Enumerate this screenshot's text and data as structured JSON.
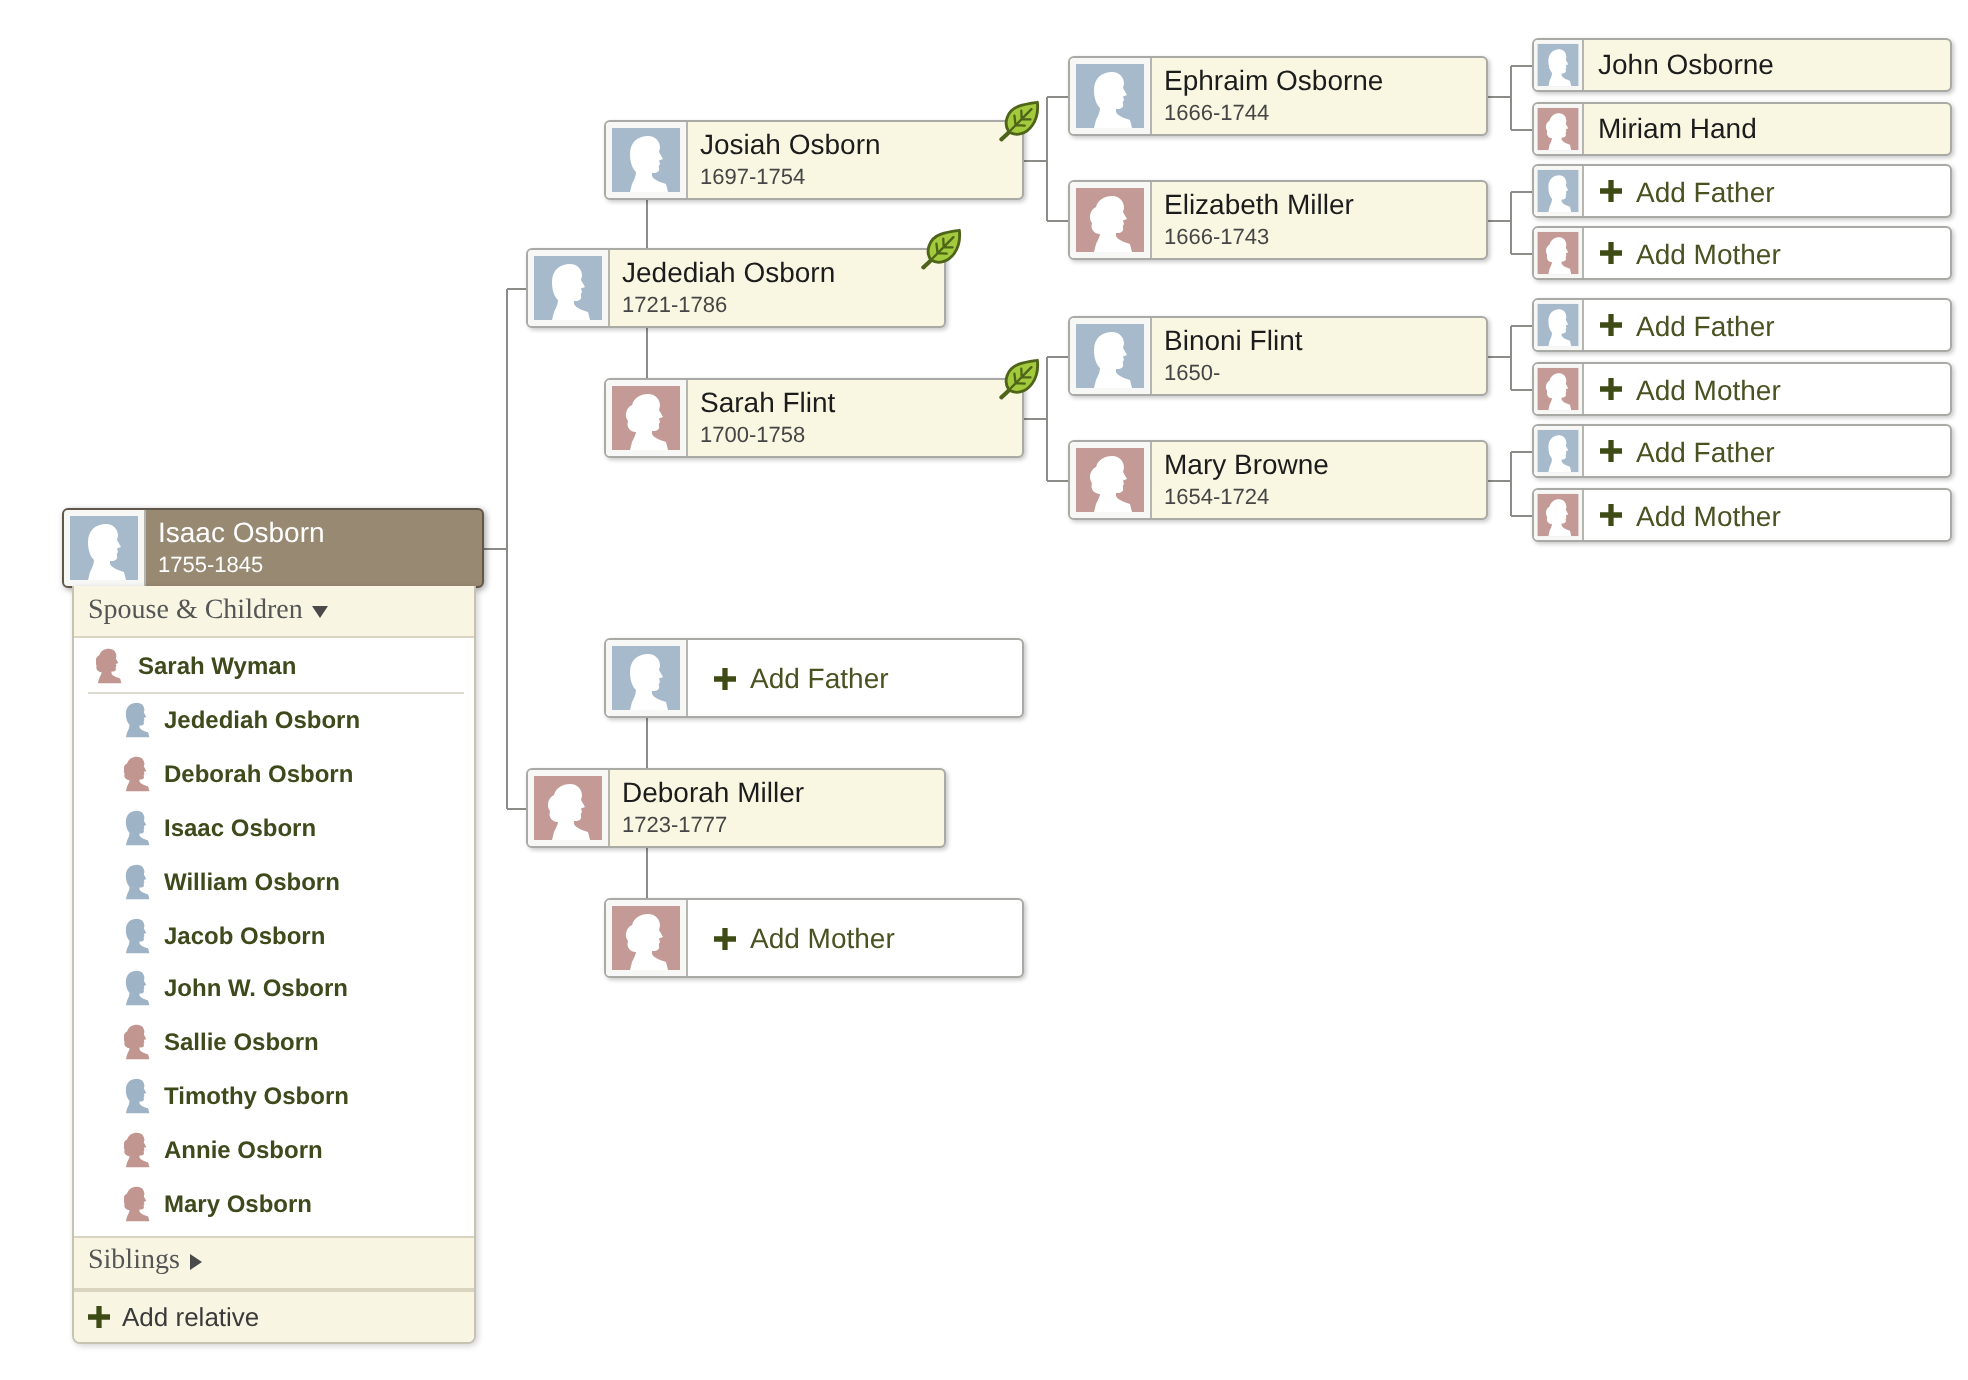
{
  "pedigree": {
    "kind": "person",
    "name": "Isaac Osborn",
    "dates": "1755-1845",
    "avatar": {
      "kind": "male",
      "color": "#a6bacb"
    },
    "selected": true,
    "hint": false,
    "parents": [
      {
        "kind": "person",
        "name": "Jedediah Osborn",
        "dates": "1721-1786",
        "avatar": {
          "kind": "male",
          "color": "#a6bacb"
        },
        "selected": false,
        "hint": true,
        "parents": [
          {
            "kind": "person",
            "name": "Josiah Osborn",
            "dates": "1697-1754",
            "avatar": {
              "kind": "male",
              "color": "#a6bacb"
            },
            "selected": false,
            "hint": true,
            "parents": [
              {
                "kind": "person",
                "name": "Ephraim Osborne",
                "dates": "1666-1744",
                "avatar": {
                  "kind": "male",
                  "color": "#a6bacb"
                },
                "selected": false,
                "hint": false,
                "parents": [
                  {
                    "kind": "person",
                    "name": "John Osborne",
                    "avatar": {
                      "kind": "male",
                      "color": "#a6bacb"
                    },
                    "selected": false,
                    "hint": false
                  },
                  {
                    "kind": "person",
                    "name": "Miriam Hand",
                    "avatar": {
                      "kind": "female",
                      "color": "#c39a95"
                    },
                    "selected": false,
                    "hint": false
                  }
                ]
              },
              {
                "kind": "person",
                "name": "Elizabeth Miller",
                "dates": "1666-1743",
                "avatar": {
                  "kind": "female",
                  "color": "#c39a95"
                },
                "selected": false,
                "hint": false,
                "parents": [
                  {
                    "kind": "add",
                    "label": "Add Father",
                    "avatar": {
                      "kind": "male",
                      "color": "#a6bacb"
                    }
                  },
                  {
                    "kind": "add",
                    "label": "Add Mother",
                    "avatar": {
                      "kind": "female",
                      "color": "#c39a95"
                    }
                  }
                ]
              }
            ]
          },
          {
            "kind": "person",
            "name": "Sarah Flint",
            "dates": "1700-1758",
            "avatar": {
              "kind": "female",
              "color": "#c39a95"
            },
            "selected": false,
            "hint": true,
            "parents": [
              {
                "kind": "person",
                "name": "Binoni Flint",
                "dates": "1650-",
                "avatar": {
                  "kind": "male",
                  "color": "#a6bacb"
                },
                "selected": false,
                "hint": false,
                "parents": [
                  {
                    "kind": "add",
                    "label": "Add Father",
                    "avatar": {
                      "kind": "male",
                      "color": "#a6bacb"
                    }
                  },
                  {
                    "kind": "add",
                    "label": "Add Mother",
                    "avatar": {
                      "kind": "female",
                      "color": "#c39a95"
                    }
                  }
                ]
              },
              {
                "kind": "person",
                "name": "Mary Browne",
                "dates": "1654-1724",
                "avatar": {
                  "kind": "female",
                  "color": "#c39a95"
                },
                "selected": false,
                "hint": false,
                "parents": [
                  {
                    "kind": "add",
                    "label": "Add Father",
                    "avatar": {
                      "kind": "male",
                      "color": "#a6bacb"
                    }
                  },
                  {
                    "kind": "add",
                    "label": "Add Mother",
                    "avatar": {
                      "kind": "female",
                      "color": "#c39a95"
                    }
                  }
                ]
              }
            ]
          }
        ]
      },
      {
        "kind": "person",
        "name": "Deborah Miller",
        "dates": "1723-1777",
        "avatar": {
          "kind": "female",
          "color": "#c39a95"
        },
        "selected": false,
        "hint": false,
        "parents": [
          {
            "kind": "add",
            "label": "Add Father",
            "avatar": {
              "kind": "male",
              "color": "#a6bacb"
            }
          },
          {
            "kind": "add",
            "label": "Add Mother",
            "avatar": {
              "kind": "female",
              "color": "#c39a95"
            }
          }
        ]
      }
    ]
  },
  "family_panel": {
    "sections": [
      {
        "title": "Spouse & Children",
        "expanded": true,
        "spouse": {
          "name": "Sarah Wyman",
          "avatar": {
            "kind": "female",
            "color": "#c29690"
          }
        },
        "children": [
          {
            "name": "Jedediah Osborn",
            "avatar": {
              "kind": "male",
              "color": "#9fb3c6"
            }
          },
          {
            "name": "Deborah Osborn",
            "avatar": {
              "kind": "female",
              "color": "#c29690"
            }
          },
          {
            "name": "Isaac Osborn",
            "avatar": {
              "kind": "male",
              "color": "#9fb3c6"
            }
          },
          {
            "name": "William Osborn",
            "avatar": {
              "kind": "male",
              "color": "#9fb3c6"
            }
          },
          {
            "name": "Jacob Osborn",
            "avatar": {
              "kind": "male",
              "color": "#9fb3c6"
            }
          },
          {
            "name": "John W. Osborn",
            "avatar": {
              "kind": "male",
              "color": "#9fb3c6"
            }
          },
          {
            "name": "Sallie Osborn",
            "avatar": {
              "kind": "female",
              "color": "#c29690"
            }
          },
          {
            "name": "Timothy Osborn",
            "avatar": {
              "kind": "male",
              "color": "#9fb3c6"
            }
          },
          {
            "name": "Annie Osborn",
            "avatar": {
              "kind": "female",
              "color": "#c29690"
            }
          },
          {
            "name": "Mary Osborn",
            "avatar": {
              "kind": "female",
              "color": "#c29690"
            }
          }
        ]
      },
      {
        "title": "Siblings",
        "expanded": false
      }
    ],
    "add_relative": "Add relative"
  }
}
